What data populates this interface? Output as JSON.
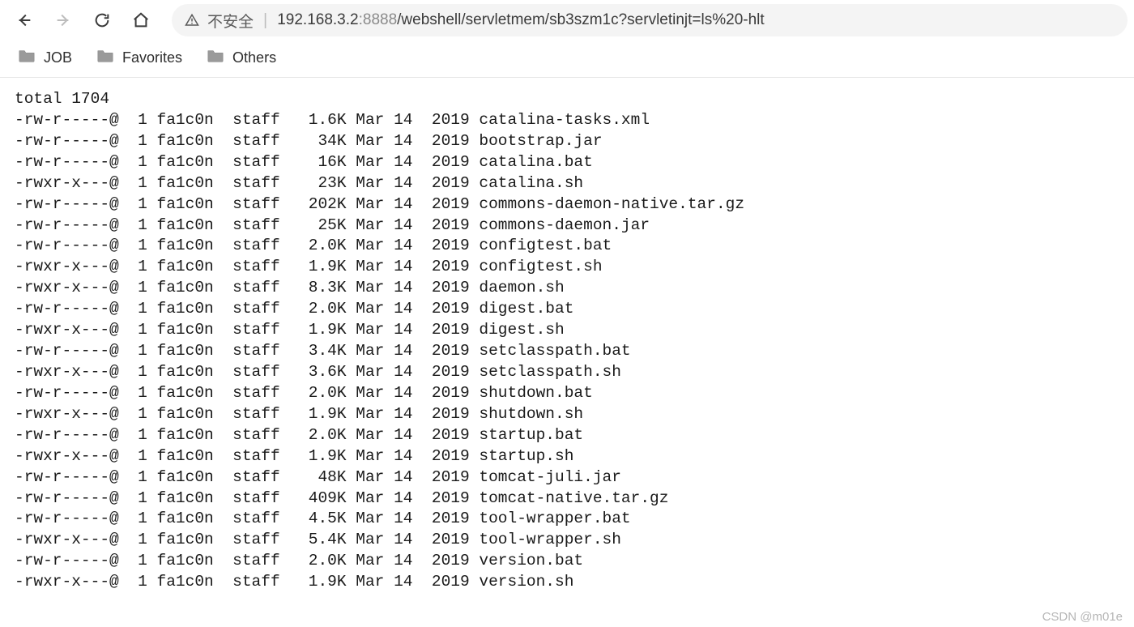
{
  "toolbar": {
    "security_label": "不安全",
    "url_host": "192.168.3.2",
    "url_port": ":8888",
    "url_path": "/webshell/servletmem/sb3szm1c?servletinjt=ls%20-hlt"
  },
  "bookmarks": [
    {
      "label": "JOB"
    },
    {
      "label": "Favorites"
    },
    {
      "label": "Others"
    }
  ],
  "listing": {
    "total_line": "total 1704",
    "rows": [
      {
        "perm": "-rw-r-----@",
        "links": "1",
        "user": "fa1c0n",
        "group": "staff",
        "size": "1.6K",
        "month": "Mar",
        "day": "14",
        "year": "2019",
        "name": "catalina-tasks.xml"
      },
      {
        "perm": "-rw-r-----@",
        "links": "1",
        "user": "fa1c0n",
        "group": "staff",
        "size": "34K",
        "month": "Mar",
        "day": "14",
        "year": "2019",
        "name": "bootstrap.jar"
      },
      {
        "perm": "-rw-r-----@",
        "links": "1",
        "user": "fa1c0n",
        "group": "staff",
        "size": "16K",
        "month": "Mar",
        "day": "14",
        "year": "2019",
        "name": "catalina.bat"
      },
      {
        "perm": "-rwxr-x---@",
        "links": "1",
        "user": "fa1c0n",
        "group": "staff",
        "size": "23K",
        "month": "Mar",
        "day": "14",
        "year": "2019",
        "name": "catalina.sh"
      },
      {
        "perm": "-rw-r-----@",
        "links": "1",
        "user": "fa1c0n",
        "group": "staff",
        "size": "202K",
        "month": "Mar",
        "day": "14",
        "year": "2019",
        "name": "commons-daemon-native.tar.gz"
      },
      {
        "perm": "-rw-r-----@",
        "links": "1",
        "user": "fa1c0n",
        "group": "staff",
        "size": "25K",
        "month": "Mar",
        "day": "14",
        "year": "2019",
        "name": "commons-daemon.jar"
      },
      {
        "perm": "-rw-r-----@",
        "links": "1",
        "user": "fa1c0n",
        "group": "staff",
        "size": "2.0K",
        "month": "Mar",
        "day": "14",
        "year": "2019",
        "name": "configtest.bat"
      },
      {
        "perm": "-rwxr-x---@",
        "links": "1",
        "user": "fa1c0n",
        "group": "staff",
        "size": "1.9K",
        "month": "Mar",
        "day": "14",
        "year": "2019",
        "name": "configtest.sh"
      },
      {
        "perm": "-rwxr-x---@",
        "links": "1",
        "user": "fa1c0n",
        "group": "staff",
        "size": "8.3K",
        "month": "Mar",
        "day": "14",
        "year": "2019",
        "name": "daemon.sh"
      },
      {
        "perm": "-rw-r-----@",
        "links": "1",
        "user": "fa1c0n",
        "group": "staff",
        "size": "2.0K",
        "month": "Mar",
        "day": "14",
        "year": "2019",
        "name": "digest.bat"
      },
      {
        "perm": "-rwxr-x---@",
        "links": "1",
        "user": "fa1c0n",
        "group": "staff",
        "size": "1.9K",
        "month": "Mar",
        "day": "14",
        "year": "2019",
        "name": "digest.sh"
      },
      {
        "perm": "-rw-r-----@",
        "links": "1",
        "user": "fa1c0n",
        "group": "staff",
        "size": "3.4K",
        "month": "Mar",
        "day": "14",
        "year": "2019",
        "name": "setclasspath.bat"
      },
      {
        "perm": "-rwxr-x---@",
        "links": "1",
        "user": "fa1c0n",
        "group": "staff",
        "size": "3.6K",
        "month": "Mar",
        "day": "14",
        "year": "2019",
        "name": "setclasspath.sh"
      },
      {
        "perm": "-rw-r-----@",
        "links": "1",
        "user": "fa1c0n",
        "group": "staff",
        "size": "2.0K",
        "month": "Mar",
        "day": "14",
        "year": "2019",
        "name": "shutdown.bat"
      },
      {
        "perm": "-rwxr-x---@",
        "links": "1",
        "user": "fa1c0n",
        "group": "staff",
        "size": "1.9K",
        "month": "Mar",
        "day": "14",
        "year": "2019",
        "name": "shutdown.sh"
      },
      {
        "perm": "-rw-r-----@",
        "links": "1",
        "user": "fa1c0n",
        "group": "staff",
        "size": "2.0K",
        "month": "Mar",
        "day": "14",
        "year": "2019",
        "name": "startup.bat"
      },
      {
        "perm": "-rwxr-x---@",
        "links": "1",
        "user": "fa1c0n",
        "group": "staff",
        "size": "1.9K",
        "month": "Mar",
        "day": "14",
        "year": "2019",
        "name": "startup.sh"
      },
      {
        "perm": "-rw-r-----@",
        "links": "1",
        "user": "fa1c0n",
        "group": "staff",
        "size": "48K",
        "month": "Mar",
        "day": "14",
        "year": "2019",
        "name": "tomcat-juli.jar"
      },
      {
        "perm": "-rw-r-----@",
        "links": "1",
        "user": "fa1c0n",
        "group": "staff",
        "size": "409K",
        "month": "Mar",
        "day": "14",
        "year": "2019",
        "name": "tomcat-native.tar.gz"
      },
      {
        "perm": "-rw-r-----@",
        "links": "1",
        "user": "fa1c0n",
        "group": "staff",
        "size": "4.5K",
        "month": "Mar",
        "day": "14",
        "year": "2019",
        "name": "tool-wrapper.bat"
      },
      {
        "perm": "-rwxr-x---@",
        "links": "1",
        "user": "fa1c0n",
        "group": "staff",
        "size": "5.4K",
        "month": "Mar",
        "day": "14",
        "year": "2019",
        "name": "tool-wrapper.sh"
      },
      {
        "perm": "-rw-r-----@",
        "links": "1",
        "user": "fa1c0n",
        "group": "staff",
        "size": "2.0K",
        "month": "Mar",
        "day": "14",
        "year": "2019",
        "name": "version.bat"
      },
      {
        "perm": "-rwxr-x---@",
        "links": "1",
        "user": "fa1c0n",
        "group": "staff",
        "size": "1.9K",
        "month": "Mar",
        "day": "14",
        "year": "2019",
        "name": "version.sh"
      }
    ]
  },
  "watermark": "CSDN @m01e"
}
